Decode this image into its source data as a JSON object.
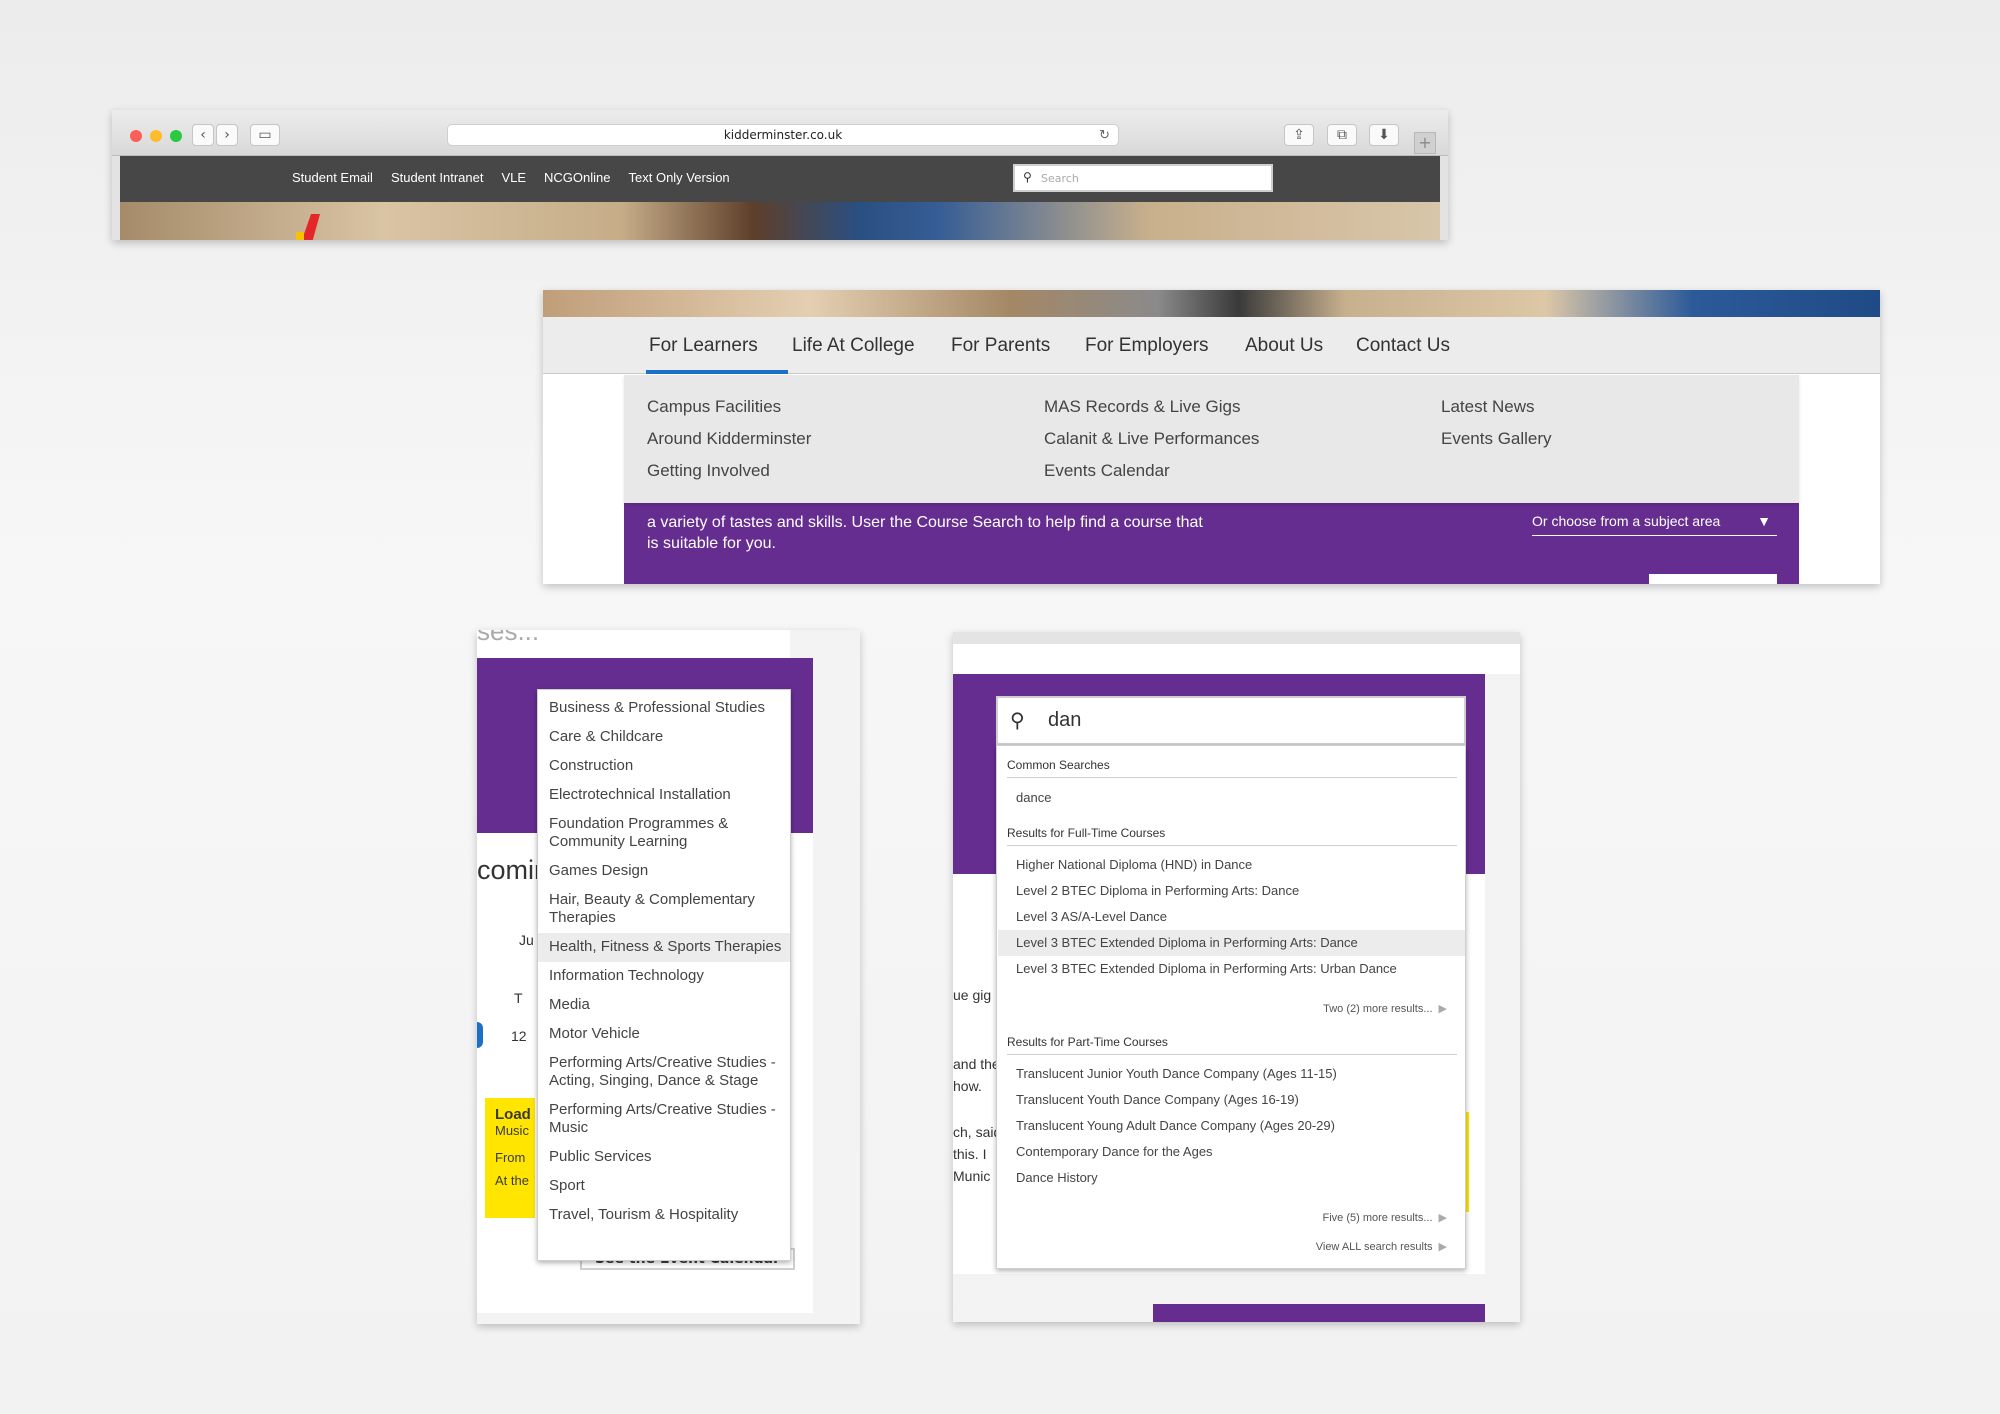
{
  "browser": {
    "url": "kidderminster.co.uk",
    "top_links": [
      "Student Email",
      "Student Intranet",
      "VLE",
      "NCGOnline",
      "Text Only Version"
    ],
    "search_placeholder": "Search"
  },
  "nav": {
    "items": [
      "For Learners",
      "Life At College",
      "For Parents",
      "For Employers",
      "About Us",
      "Contact Us"
    ],
    "active": "For Learners",
    "mega_columns": [
      [
        "Campus Facilities",
        "Around Kidderminster",
        "Getting Involved"
      ],
      [
        "MAS Records & Live Gigs",
        "Calanit & Live Performances",
        "Events Calendar"
      ],
      [
        "Latest News",
        "Events Gallery"
      ]
    ],
    "intro_text": "a variety of tastes and skills. User the Course Search to help find a course that is suitable for you.",
    "subject_select": "Or choose from a subject area"
  },
  "subjects_panel": {
    "top_fragment": "ses...",
    "heading_fragment": "comin",
    "bg_labels": [
      "Ju",
      "T",
      "12",
      "Load",
      "Music",
      "From",
      "At the"
    ],
    "see_event_button": "See the Event Calendar",
    "items": [
      "Business & Professional Studies",
      "Care & Childcare",
      "Construction",
      "Electrotechnical Installation",
      "Foundation Programmes & Community Learning",
      "Games Design",
      "Hair, Beauty & Complementary Therapies",
      "Health, Fitness & Sports Therapies",
      "Information Technology",
      "Media",
      "Motor Vehicle",
      "Performing Arts/Creative Studies - Acting, Singing, Dance & Stage",
      "Performing Arts/Creative Studies - Music",
      "Public Services",
      "Sport",
      "Travel, Tourism & Hospitality"
    ],
    "highlighted": "Health, Fitness & Sports Therapies"
  },
  "search_panel": {
    "query": "dan",
    "bg_labels": [
      "ue gig",
      "and the",
      "how.",
      "ch, said",
      "this. I",
      "Munic"
    ],
    "common_heading": "Common Searches",
    "common": [
      "dance"
    ],
    "fulltime_heading": "Results for Full-Time Courses",
    "fulltime": [
      "Higher National Diploma (HND) in Dance",
      "Level 2 BTEC Diploma in Performing Arts: Dance",
      "Level 3 AS/A-Level Dance",
      "Level 3 BTEC Extended Diploma in Performing Arts: Dance",
      "Level 3 BTEC Extended Diploma in Performing Arts: Urban Dance"
    ],
    "fulltime_highlighted_index": 3,
    "fulltime_more": "Two (2) more results...",
    "parttime_heading": "Results for Part-Time Courses",
    "parttime": [
      "Translucent Junior Youth Dance Company (Ages 11-15)",
      "Translucent Youth Dance Company (Ages 16-19)",
      "Translucent Young Adult Dance Company (Ages 20-29)",
      "Contemporary Dance for the Ages",
      "Dance History"
    ],
    "parttime_more": "Five (5) more results...",
    "view_all": "View ALL search results"
  },
  "colors": {
    "brand_purple": "#662d91",
    "active_blue": "#1d70c8",
    "event_yellow": "#ffe500"
  }
}
